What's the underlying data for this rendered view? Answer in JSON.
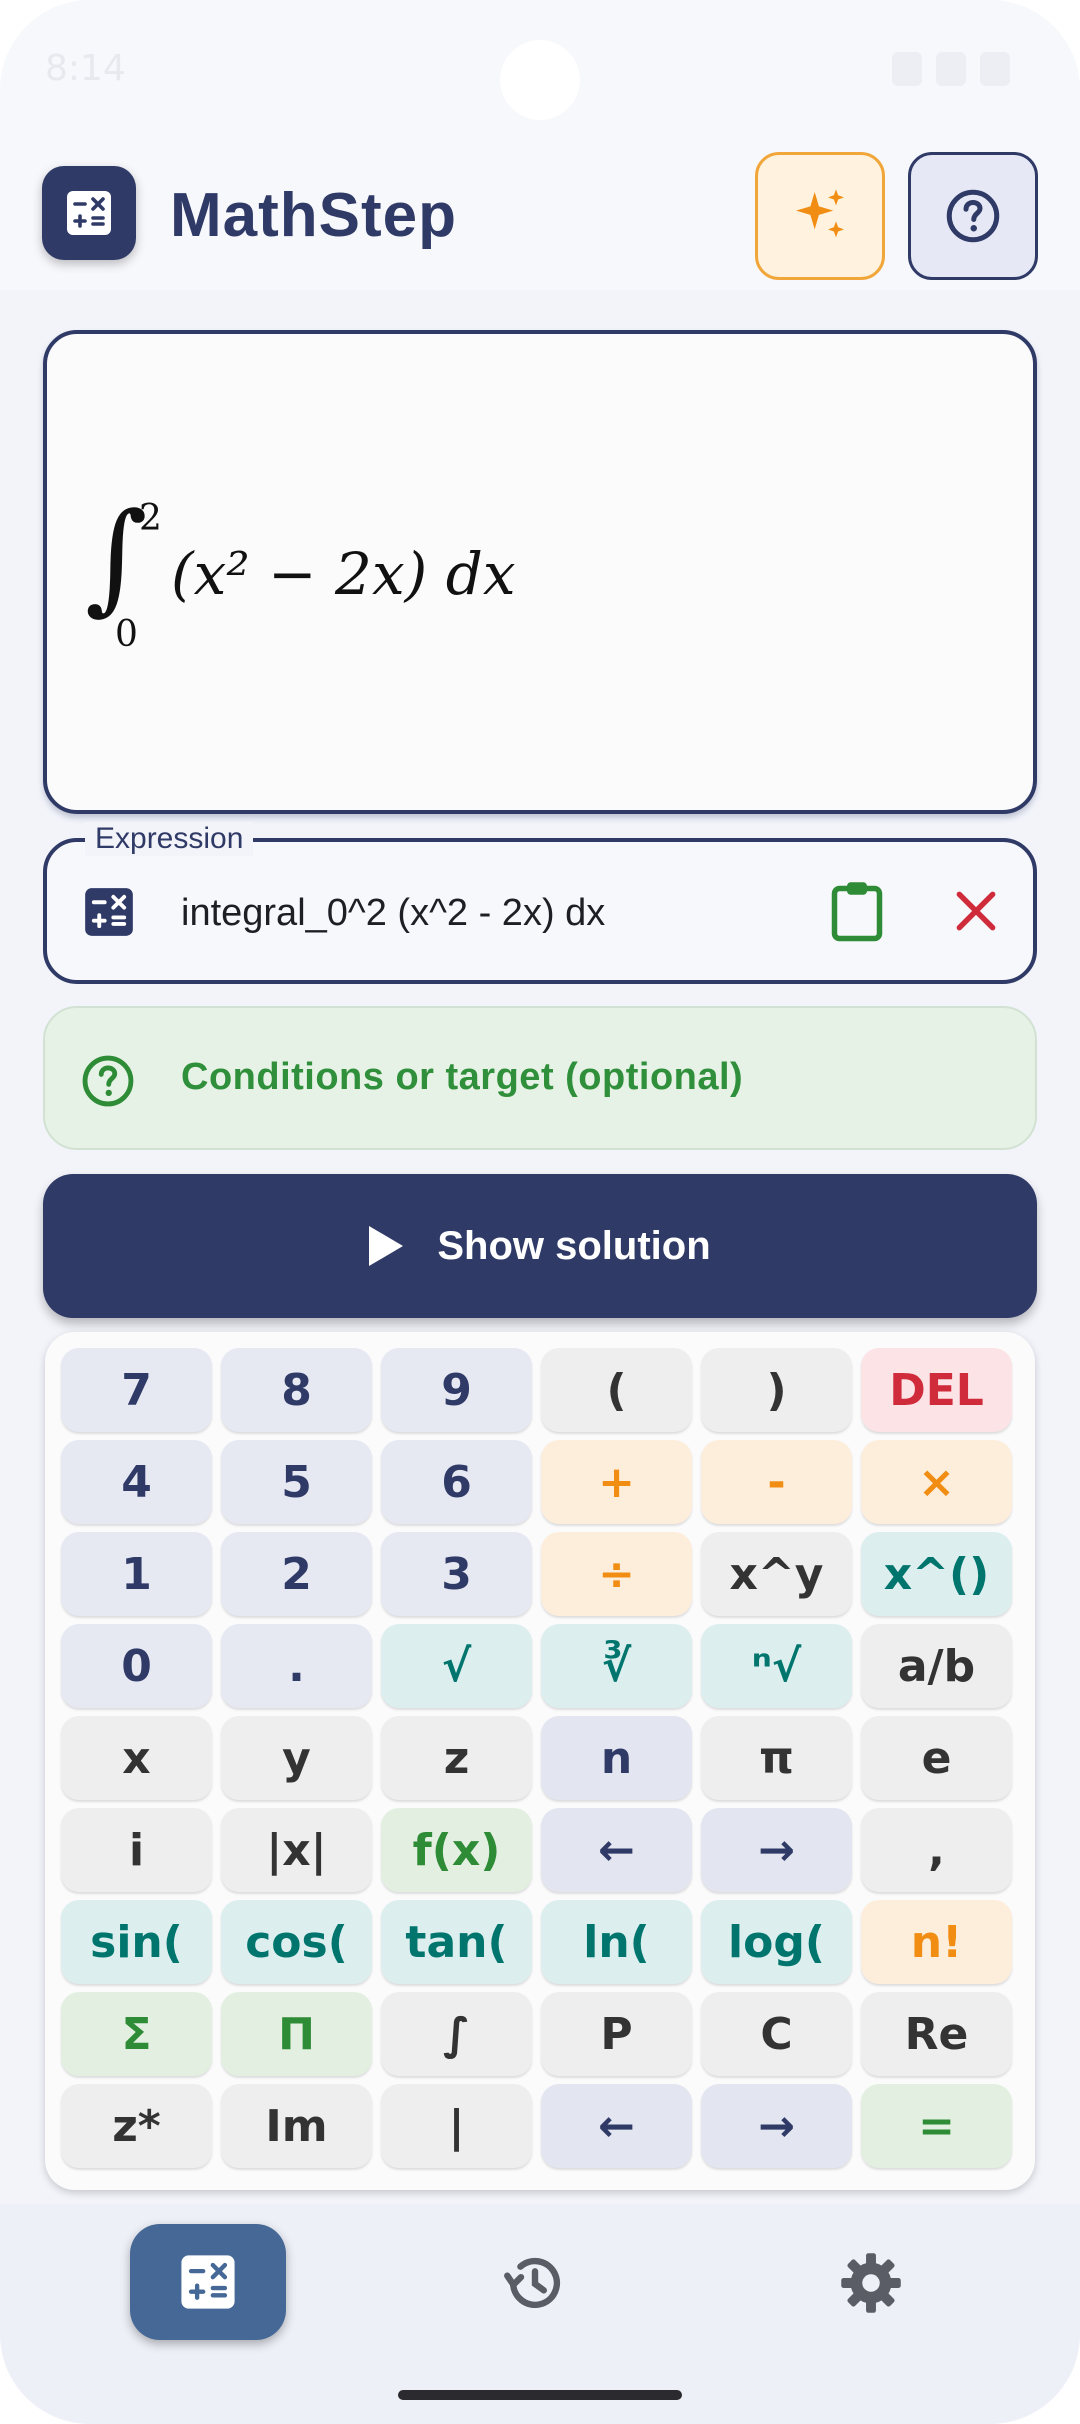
{
  "status_bar": {
    "time": "8:14"
  },
  "app": {
    "title": "MathStep"
  },
  "preview": {
    "upper_limit": "2",
    "lower_limit": "0",
    "integrand": "(x² − 2x) dx"
  },
  "expression": {
    "label": "Expression",
    "value": "integral_0^2 (x^2 - 2x) dx"
  },
  "conditions": {
    "label": "Conditions or target (optional)"
  },
  "solve_button": {
    "label": "Show solution"
  },
  "keypad": {
    "rows": [
      [
        "7",
        "8",
        "9",
        "(",
        ")",
        "DEL"
      ],
      [
        "4",
        "5",
        "6",
        "+",
        "-",
        "×"
      ],
      [
        "1",
        "2",
        "3",
        "÷",
        "x^y",
        "x^()"
      ],
      [
        "0",
        ".",
        "√",
        "∛",
        "ⁿ√",
        "a/b"
      ],
      [
        "x",
        "y",
        "z",
        "n",
        "π",
        "e"
      ],
      [
        "i",
        "|x|",
        "f(x)",
        "←",
        "→",
        ","
      ],
      [
        "sin(",
        "cos(",
        "tan(",
        "ln(",
        "log(",
        "n!"
      ],
      [
        "Σ",
        "Π",
        "∫",
        "P",
        "C",
        "Re"
      ],
      [
        "z*",
        "Im",
        "|",
        "←",
        "→",
        "="
      ]
    ]
  },
  "colors": {
    "primary": "#2f3a67",
    "accent_orange": "#f08d12",
    "accent_teal": "#00756e",
    "accent_green": "#2e8b36",
    "danger": "#d02b3a"
  },
  "icons": {
    "logo": "calculator-icon",
    "sparkle": "sparkle-icon",
    "help": "help-circle-icon",
    "paste": "clipboard-icon",
    "clear": "close-icon",
    "play": "play-icon",
    "history": "history-icon",
    "settings": "gear-icon"
  }
}
